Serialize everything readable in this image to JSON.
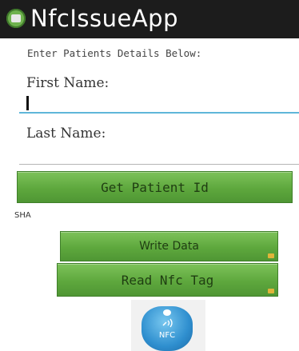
{
  "action_bar": {
    "title": "NfcIssueApp",
    "icon": "android-app-icon"
  },
  "form": {
    "instructions": "Enter Patients Details Below:",
    "first_name_label": "First Name:",
    "first_name_value": "",
    "last_name_label": "Last Name:",
    "last_name_value": ""
  },
  "buttons": {
    "get_patient_id": "Get Patient Id",
    "write_data": "Write Data",
    "read_nfc_tag": "Read Nfc Tag"
  },
  "hash_text": "SHA",
  "nfc_image": {
    "label": "NFC",
    "icon": "nfc-tag-icon"
  },
  "colors": {
    "action_bar": "#1c1c1c",
    "button_green": "#5ea83d",
    "input_focus": "#5fb6d9",
    "nfc_blue": "#2f8fcf"
  }
}
